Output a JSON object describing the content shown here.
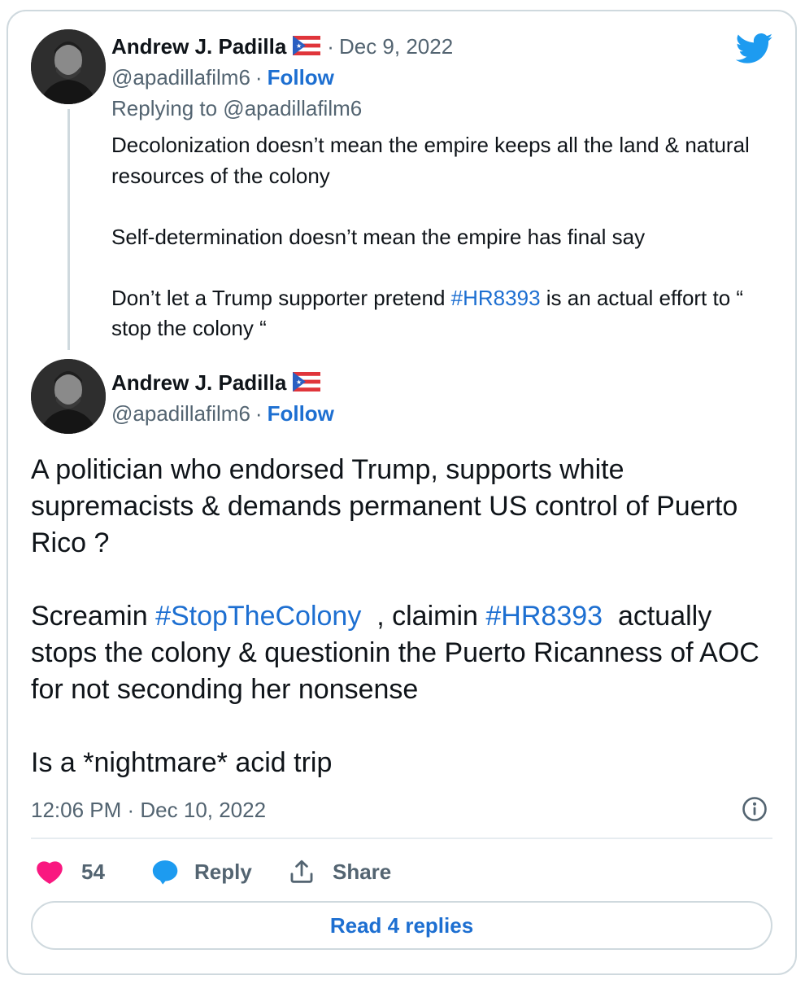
{
  "brand": {
    "icon": "twitter-bird-icon",
    "color": "#1d9bf0"
  },
  "link_color": "#1d6fd1",
  "parent_tweet": {
    "author_name": "Andrew J. Padilla",
    "flag_icon": "puerto-rico-flag-icon",
    "date_sep": "·",
    "date": "Dec 9, 2022",
    "handle": "@apadillafilm6",
    "handle_sep": "·",
    "follow_label": "Follow",
    "replying_to": "Replying to @apadillafilm6",
    "text": {
      "p1": "Decolonization doesn’t mean the empire keeps all the land & natural resources of the colony",
      "p2": "Self-determination doesn’t mean the empire has final say",
      "p3_before": "Don’t let a Trump supporter pretend ",
      "p3_hashtag": "#HR8393",
      "p3_after": " is an actual effort to “ stop the colony “"
    }
  },
  "main_tweet": {
    "author_name": "Andrew J. Padilla",
    "flag_icon": "puerto-rico-flag-icon",
    "handle": "@apadillafilm6",
    "handle_sep": "·",
    "follow_label": "Follow",
    "text": {
      "p1": "A politician who endorsed Trump,  supports white supremacists & demands permanent US control of Puerto Rico ?",
      "p2_a": "Screamin ",
      "p2_hashtag1": "#StopTheColony",
      "p2_b": "  , claimin ",
      "p2_hashtag2": "#HR8393",
      "p2_c": "  actually stops the colony & questionin the Puerto Ricanness of AOC for not seconding her nonsense",
      "p3": "Is a *nightmare* acid trip"
    },
    "timestamp": "12:06 PM · Dec 10, 2022",
    "info_icon": "info-icon"
  },
  "actions": {
    "like_count": "54",
    "like_color": "#f91880",
    "reply_label": "Reply",
    "share_label": "Share"
  },
  "read_replies_label": "Read 4 replies"
}
